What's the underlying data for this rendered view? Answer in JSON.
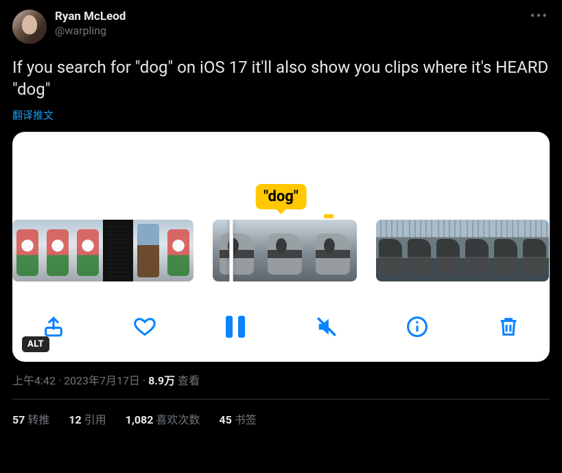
{
  "author": {
    "display_name": "Ryan McLeod",
    "handle": "@warpling"
  },
  "tweet_text": "If you search for \"dog\" on iOS 17 it'll also show you clips where it's HEARD \"dog\"",
  "translate_label": "翻译推文",
  "media": {
    "tooltip_label": "\"dog\"",
    "alt_badge": "ALT",
    "toolbar": {
      "share": "share",
      "like": "like",
      "pause": "pause",
      "mute": "mute",
      "info": "info",
      "delete": "delete"
    }
  },
  "meta": {
    "time": "上午4:42",
    "date": "2023年7月17日",
    "views_number": "8.9万",
    "views_label": "查看",
    "separator": " · "
  },
  "stats": {
    "retweets": {
      "count": "57",
      "label": "转推"
    },
    "quotes": {
      "count": "12",
      "label": "引用"
    },
    "likes": {
      "count": "1,082",
      "label": "喜欢次数"
    },
    "bookmarks": {
      "count": "45",
      "label": "书签"
    }
  }
}
